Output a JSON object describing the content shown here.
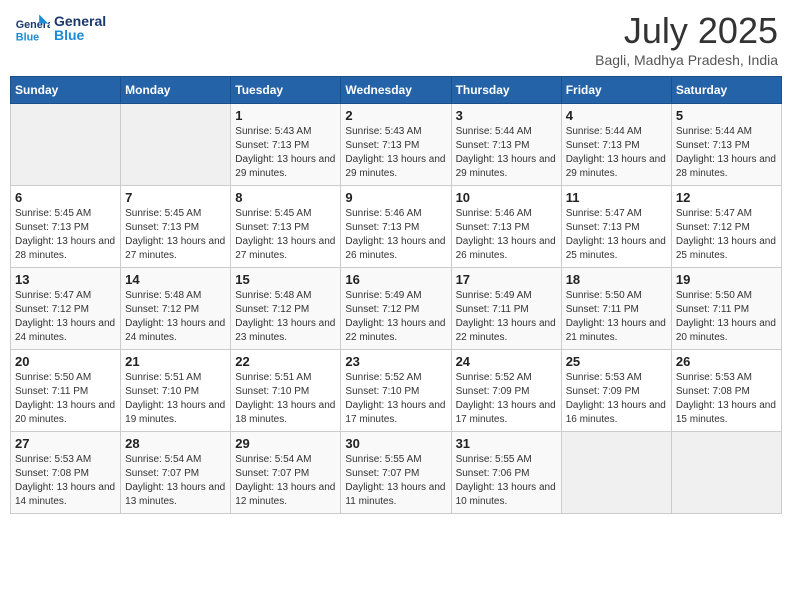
{
  "header": {
    "logo_general": "General",
    "logo_blue": "Blue",
    "month_title": "July 2025",
    "location": "Bagli, Madhya Pradesh, India"
  },
  "days_of_week": [
    "Sunday",
    "Monday",
    "Tuesday",
    "Wednesday",
    "Thursday",
    "Friday",
    "Saturday"
  ],
  "weeks": [
    [
      {
        "num": "",
        "sunrise": "",
        "sunset": "",
        "daylight": ""
      },
      {
        "num": "",
        "sunrise": "",
        "sunset": "",
        "daylight": ""
      },
      {
        "num": "1",
        "sunrise": "Sunrise: 5:43 AM",
        "sunset": "Sunset: 7:13 PM",
        "daylight": "Daylight: 13 hours and 29 minutes."
      },
      {
        "num": "2",
        "sunrise": "Sunrise: 5:43 AM",
        "sunset": "Sunset: 7:13 PM",
        "daylight": "Daylight: 13 hours and 29 minutes."
      },
      {
        "num": "3",
        "sunrise": "Sunrise: 5:44 AM",
        "sunset": "Sunset: 7:13 PM",
        "daylight": "Daylight: 13 hours and 29 minutes."
      },
      {
        "num": "4",
        "sunrise": "Sunrise: 5:44 AM",
        "sunset": "Sunset: 7:13 PM",
        "daylight": "Daylight: 13 hours and 29 minutes."
      },
      {
        "num": "5",
        "sunrise": "Sunrise: 5:44 AM",
        "sunset": "Sunset: 7:13 PM",
        "daylight": "Daylight: 13 hours and 28 minutes."
      }
    ],
    [
      {
        "num": "6",
        "sunrise": "Sunrise: 5:45 AM",
        "sunset": "Sunset: 7:13 PM",
        "daylight": "Daylight: 13 hours and 28 minutes."
      },
      {
        "num": "7",
        "sunrise": "Sunrise: 5:45 AM",
        "sunset": "Sunset: 7:13 PM",
        "daylight": "Daylight: 13 hours and 27 minutes."
      },
      {
        "num": "8",
        "sunrise": "Sunrise: 5:45 AM",
        "sunset": "Sunset: 7:13 PM",
        "daylight": "Daylight: 13 hours and 27 minutes."
      },
      {
        "num": "9",
        "sunrise": "Sunrise: 5:46 AM",
        "sunset": "Sunset: 7:13 PM",
        "daylight": "Daylight: 13 hours and 26 minutes."
      },
      {
        "num": "10",
        "sunrise": "Sunrise: 5:46 AM",
        "sunset": "Sunset: 7:13 PM",
        "daylight": "Daylight: 13 hours and 26 minutes."
      },
      {
        "num": "11",
        "sunrise": "Sunrise: 5:47 AM",
        "sunset": "Sunset: 7:13 PM",
        "daylight": "Daylight: 13 hours and 25 minutes."
      },
      {
        "num": "12",
        "sunrise": "Sunrise: 5:47 AM",
        "sunset": "Sunset: 7:12 PM",
        "daylight": "Daylight: 13 hours and 25 minutes."
      }
    ],
    [
      {
        "num": "13",
        "sunrise": "Sunrise: 5:47 AM",
        "sunset": "Sunset: 7:12 PM",
        "daylight": "Daylight: 13 hours and 24 minutes."
      },
      {
        "num": "14",
        "sunrise": "Sunrise: 5:48 AM",
        "sunset": "Sunset: 7:12 PM",
        "daylight": "Daylight: 13 hours and 24 minutes."
      },
      {
        "num": "15",
        "sunrise": "Sunrise: 5:48 AM",
        "sunset": "Sunset: 7:12 PM",
        "daylight": "Daylight: 13 hours and 23 minutes."
      },
      {
        "num": "16",
        "sunrise": "Sunrise: 5:49 AM",
        "sunset": "Sunset: 7:12 PM",
        "daylight": "Daylight: 13 hours and 22 minutes."
      },
      {
        "num": "17",
        "sunrise": "Sunrise: 5:49 AM",
        "sunset": "Sunset: 7:11 PM",
        "daylight": "Daylight: 13 hours and 22 minutes."
      },
      {
        "num": "18",
        "sunrise": "Sunrise: 5:50 AM",
        "sunset": "Sunset: 7:11 PM",
        "daylight": "Daylight: 13 hours and 21 minutes."
      },
      {
        "num": "19",
        "sunrise": "Sunrise: 5:50 AM",
        "sunset": "Sunset: 7:11 PM",
        "daylight": "Daylight: 13 hours and 20 minutes."
      }
    ],
    [
      {
        "num": "20",
        "sunrise": "Sunrise: 5:50 AM",
        "sunset": "Sunset: 7:11 PM",
        "daylight": "Daylight: 13 hours and 20 minutes."
      },
      {
        "num": "21",
        "sunrise": "Sunrise: 5:51 AM",
        "sunset": "Sunset: 7:10 PM",
        "daylight": "Daylight: 13 hours and 19 minutes."
      },
      {
        "num": "22",
        "sunrise": "Sunrise: 5:51 AM",
        "sunset": "Sunset: 7:10 PM",
        "daylight": "Daylight: 13 hours and 18 minutes."
      },
      {
        "num": "23",
        "sunrise": "Sunrise: 5:52 AM",
        "sunset": "Sunset: 7:10 PM",
        "daylight": "Daylight: 13 hours and 17 minutes."
      },
      {
        "num": "24",
        "sunrise": "Sunrise: 5:52 AM",
        "sunset": "Sunset: 7:09 PM",
        "daylight": "Daylight: 13 hours and 17 minutes."
      },
      {
        "num": "25",
        "sunrise": "Sunrise: 5:53 AM",
        "sunset": "Sunset: 7:09 PM",
        "daylight": "Daylight: 13 hours and 16 minutes."
      },
      {
        "num": "26",
        "sunrise": "Sunrise: 5:53 AM",
        "sunset": "Sunset: 7:08 PM",
        "daylight": "Daylight: 13 hours and 15 minutes."
      }
    ],
    [
      {
        "num": "27",
        "sunrise": "Sunrise: 5:53 AM",
        "sunset": "Sunset: 7:08 PM",
        "daylight": "Daylight: 13 hours and 14 minutes."
      },
      {
        "num": "28",
        "sunrise": "Sunrise: 5:54 AM",
        "sunset": "Sunset: 7:07 PM",
        "daylight": "Daylight: 13 hours and 13 minutes."
      },
      {
        "num": "29",
        "sunrise": "Sunrise: 5:54 AM",
        "sunset": "Sunset: 7:07 PM",
        "daylight": "Daylight: 13 hours and 12 minutes."
      },
      {
        "num": "30",
        "sunrise": "Sunrise: 5:55 AM",
        "sunset": "Sunset: 7:07 PM",
        "daylight": "Daylight: 13 hours and 11 minutes."
      },
      {
        "num": "31",
        "sunrise": "Sunrise: 5:55 AM",
        "sunset": "Sunset: 7:06 PM",
        "daylight": "Daylight: 13 hours and 10 minutes."
      },
      {
        "num": "",
        "sunrise": "",
        "sunset": "",
        "daylight": ""
      },
      {
        "num": "",
        "sunrise": "",
        "sunset": "",
        "daylight": ""
      }
    ]
  ]
}
